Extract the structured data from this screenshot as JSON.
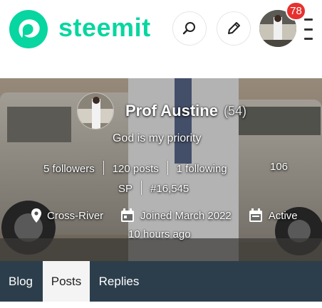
{
  "brand": {
    "name": "steemit",
    "color": "#07d6a0"
  },
  "header": {
    "search_icon": "search-icon",
    "edit_icon": "pencil-icon",
    "notifications": "78",
    "menu_icon": "vertical-menu-icon"
  },
  "profile": {
    "name": "Prof Austine",
    "reputation": "(54)",
    "about": "God is my priority",
    "followers": "5 followers",
    "posts": "120 posts",
    "following": "1 following",
    "sp": "106 SP",
    "rank": "#16,545",
    "location": "Cross-River",
    "joined": "Joined March 2022",
    "active": "Active 10 hours ago"
  },
  "tabs": [
    {
      "label": "Blog",
      "active": false
    },
    {
      "label": "Posts",
      "active": true
    },
    {
      "label": "Replies",
      "active": false
    }
  ],
  "colors": {
    "tabbar": "#2c3e4c",
    "badge": "#e6312e"
  }
}
